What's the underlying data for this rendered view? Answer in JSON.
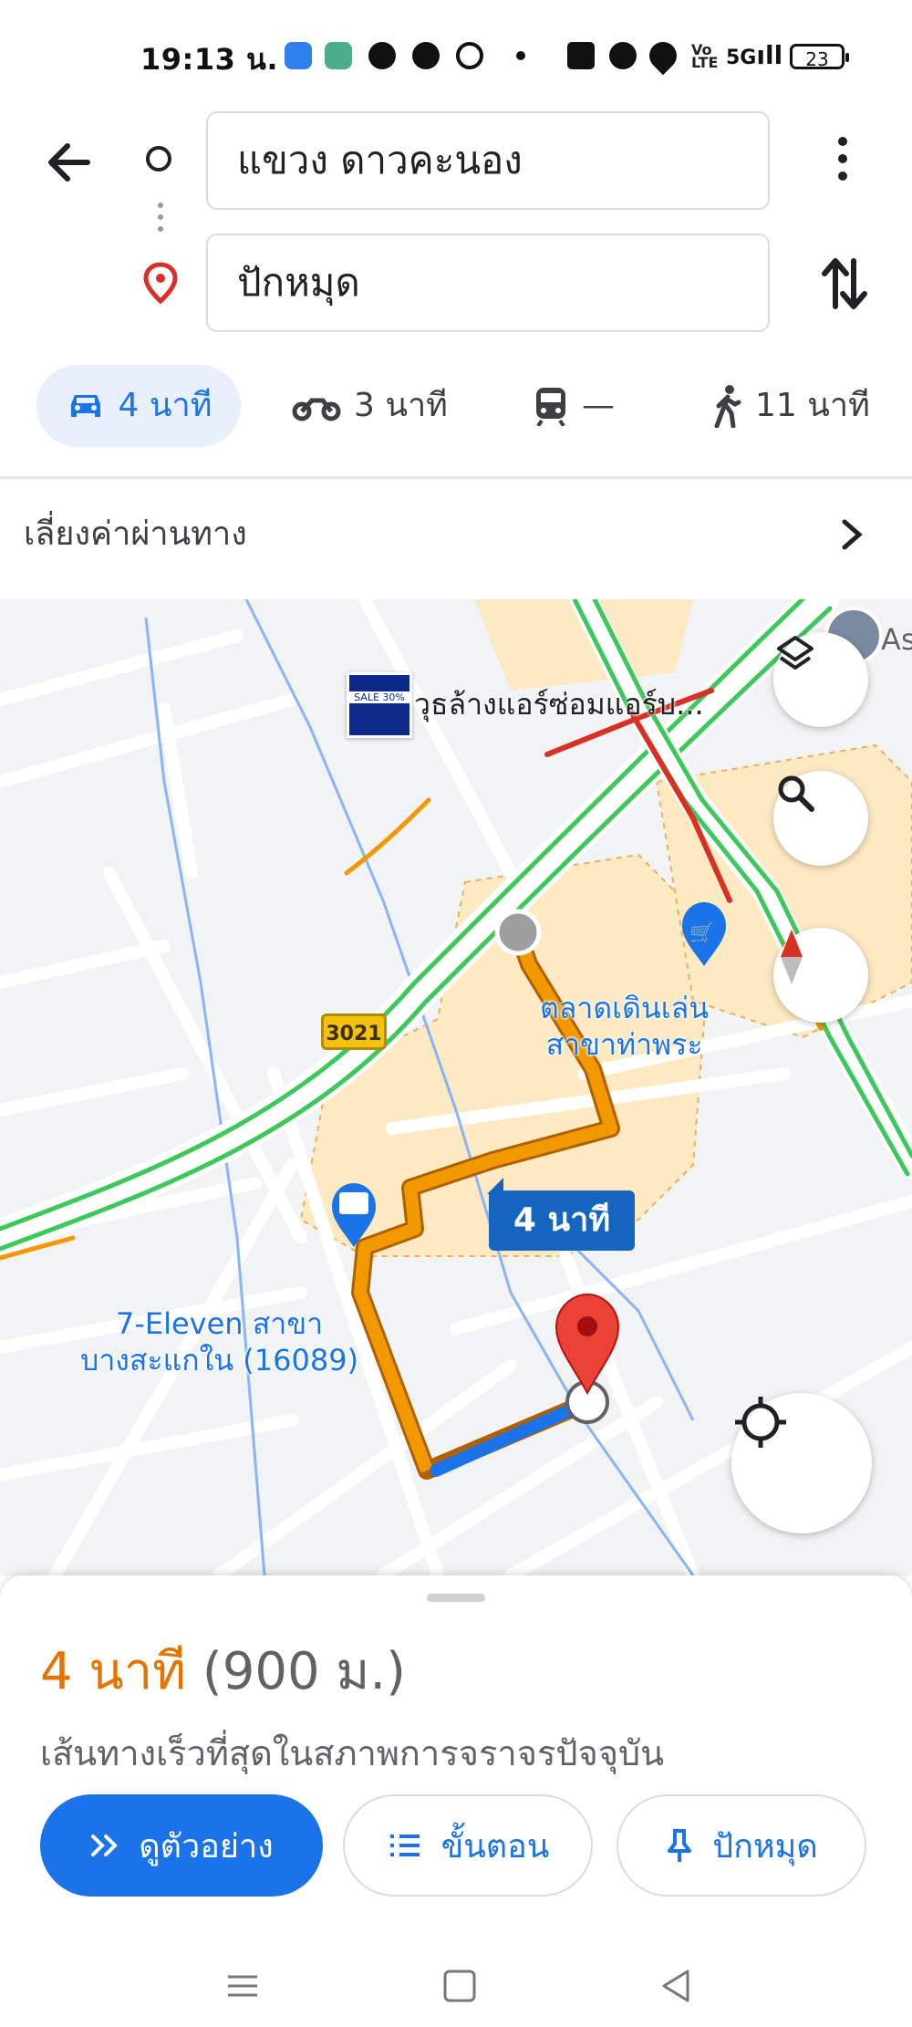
{
  "status_bar": {
    "time": "19:13 น.",
    "signal": "5G",
    "battery": "23"
  },
  "route": {
    "origin": "แขวง ดาวคะนอง",
    "destination": "ปักหมุด"
  },
  "modes": [
    {
      "name": "car",
      "label": "4 นาที"
    },
    {
      "name": "motorcycle",
      "label": "3 นาที"
    },
    {
      "name": "transit",
      "label": "—"
    },
    {
      "name": "walk",
      "label": "11 นาที"
    }
  ],
  "avoid_tolls": "เลี่ยงค่าผ่านทาง",
  "map": {
    "place_1": "วุธล้างแอร์ซ่อมแอร์บ...",
    "market": "ตลาดเดินเล่น\nสาขาท่าพระ",
    "seven_eleven": "7-Eleven สาขา\nบางสะแกใน (16089)",
    "road_number": "3021",
    "route_time": "4 นาที",
    "sale_thumb": "SALE 30%",
    "corner_label": "As"
  },
  "sheet": {
    "eta_time": "4 นาที",
    "eta_distance": "(900 ม.)",
    "fastest": "เส้นทางเร็วที่สุดในสภาพการจราจรปัจจุบัน",
    "preview_label": "ดูตัวอย่าง",
    "steps_label": "ขั้นตอน",
    "pin_label": "ปักหมุด"
  },
  "colors": {
    "accent": "#1a73e8",
    "eta": "#e37400",
    "route": "#f29900",
    "traffic_green": "#3cc85a",
    "traffic_red": "#d93025"
  }
}
